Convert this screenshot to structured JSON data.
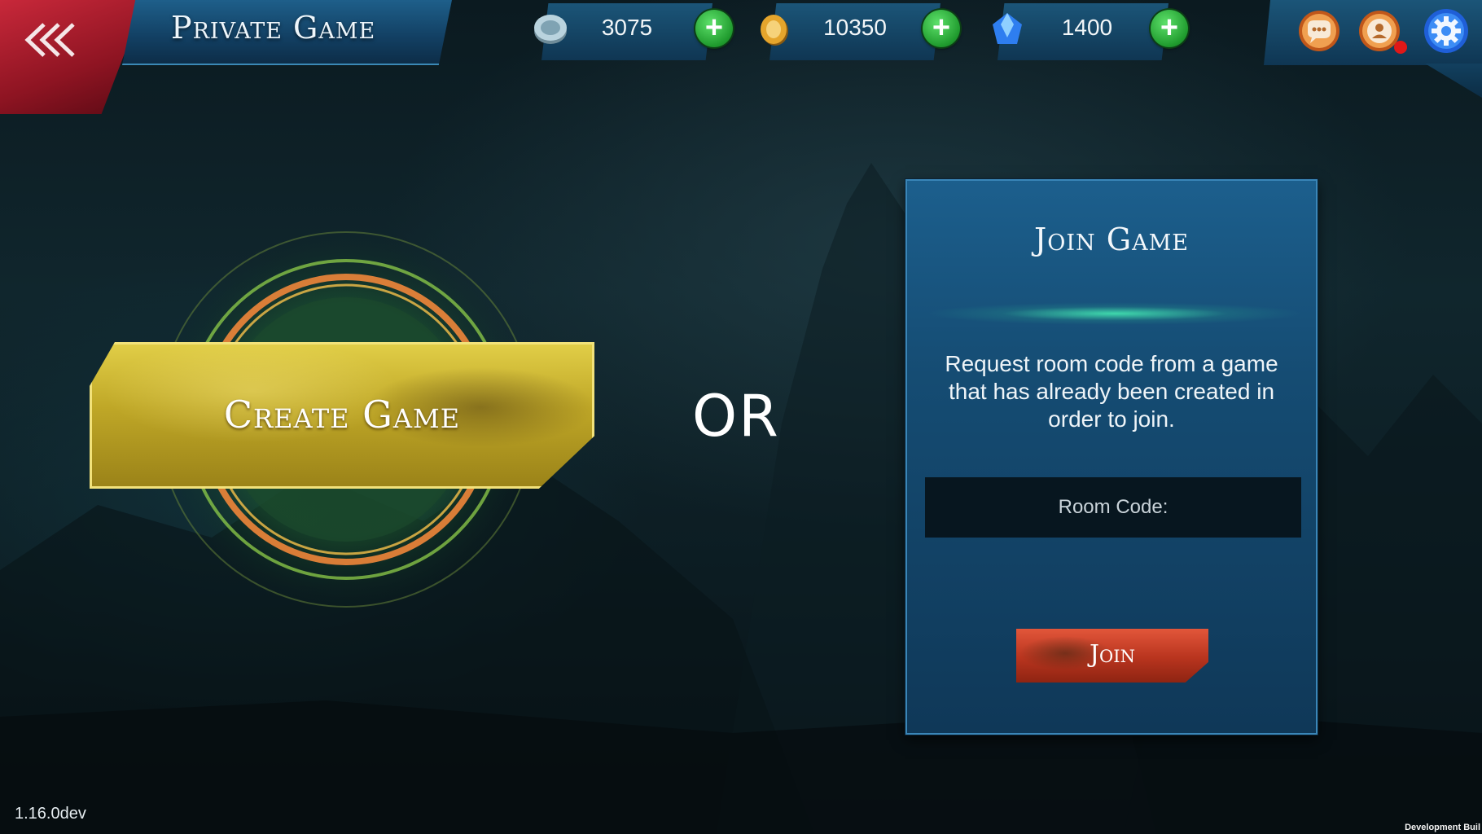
{
  "header": {
    "title": "Private Game",
    "currencies": [
      {
        "icon": "silver-token-icon",
        "value": "3075"
      },
      {
        "icon": "gold-coin-icon",
        "value": "10350"
      },
      {
        "icon": "blue-gem-icon",
        "value": "1400"
      }
    ],
    "icons": {
      "back": "triple-chevron-left-icon",
      "chat": "chat-bubble-icon",
      "profile": "profile-icon",
      "settings": "gear-icon"
    }
  },
  "create": {
    "label": "Create Game"
  },
  "separator": "OR",
  "join": {
    "title": "Join Game",
    "description": "Request room code from a game that has already been created in order to join.",
    "room_code_placeholder": "Room Code:",
    "button_label": "Join"
  },
  "footer": {
    "version": "1.16.0dev",
    "build_label": "Development Buil"
  },
  "colors": {
    "accent_blue": "#1c5f8d",
    "gold": "#c9b032",
    "join_red": "#c23a22",
    "plus_green": "#2fb33f"
  }
}
